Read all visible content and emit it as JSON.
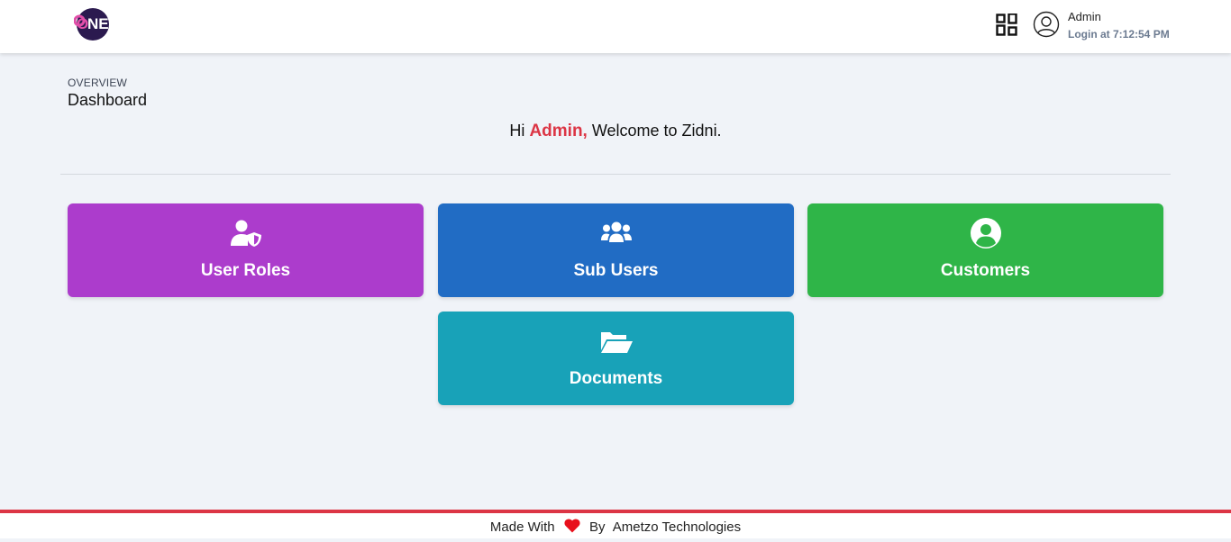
{
  "header": {
    "logo_text": "ONE",
    "apps_icon": "grid-icon",
    "user_icon": "user-circle-icon",
    "user_name": "Admin",
    "login_text": "Login at 7:12:54 PM"
  },
  "page": {
    "overview": "OVERVIEW",
    "title": "Dashboard"
  },
  "welcome": {
    "prefix": "Hi",
    "name": "Admin,",
    "suffix": "Welcome to Zidni."
  },
  "cards": [
    {
      "label": "User Roles",
      "icon": "user-shield-icon",
      "color": "#ac3ccc"
    },
    {
      "label": "Sub Users",
      "icon": "users-icon",
      "color": "#216cc4"
    },
    {
      "label": "Customers",
      "icon": "user-circle-icon",
      "color": "#2fb548"
    },
    {
      "label": "Documents",
      "icon": "folder-open-icon",
      "color": "#18a2b8"
    }
  ],
  "footer": {
    "made_with": "Made With",
    "by": "By",
    "company": "Ametzo Technologies",
    "accent": "#dc3545"
  }
}
